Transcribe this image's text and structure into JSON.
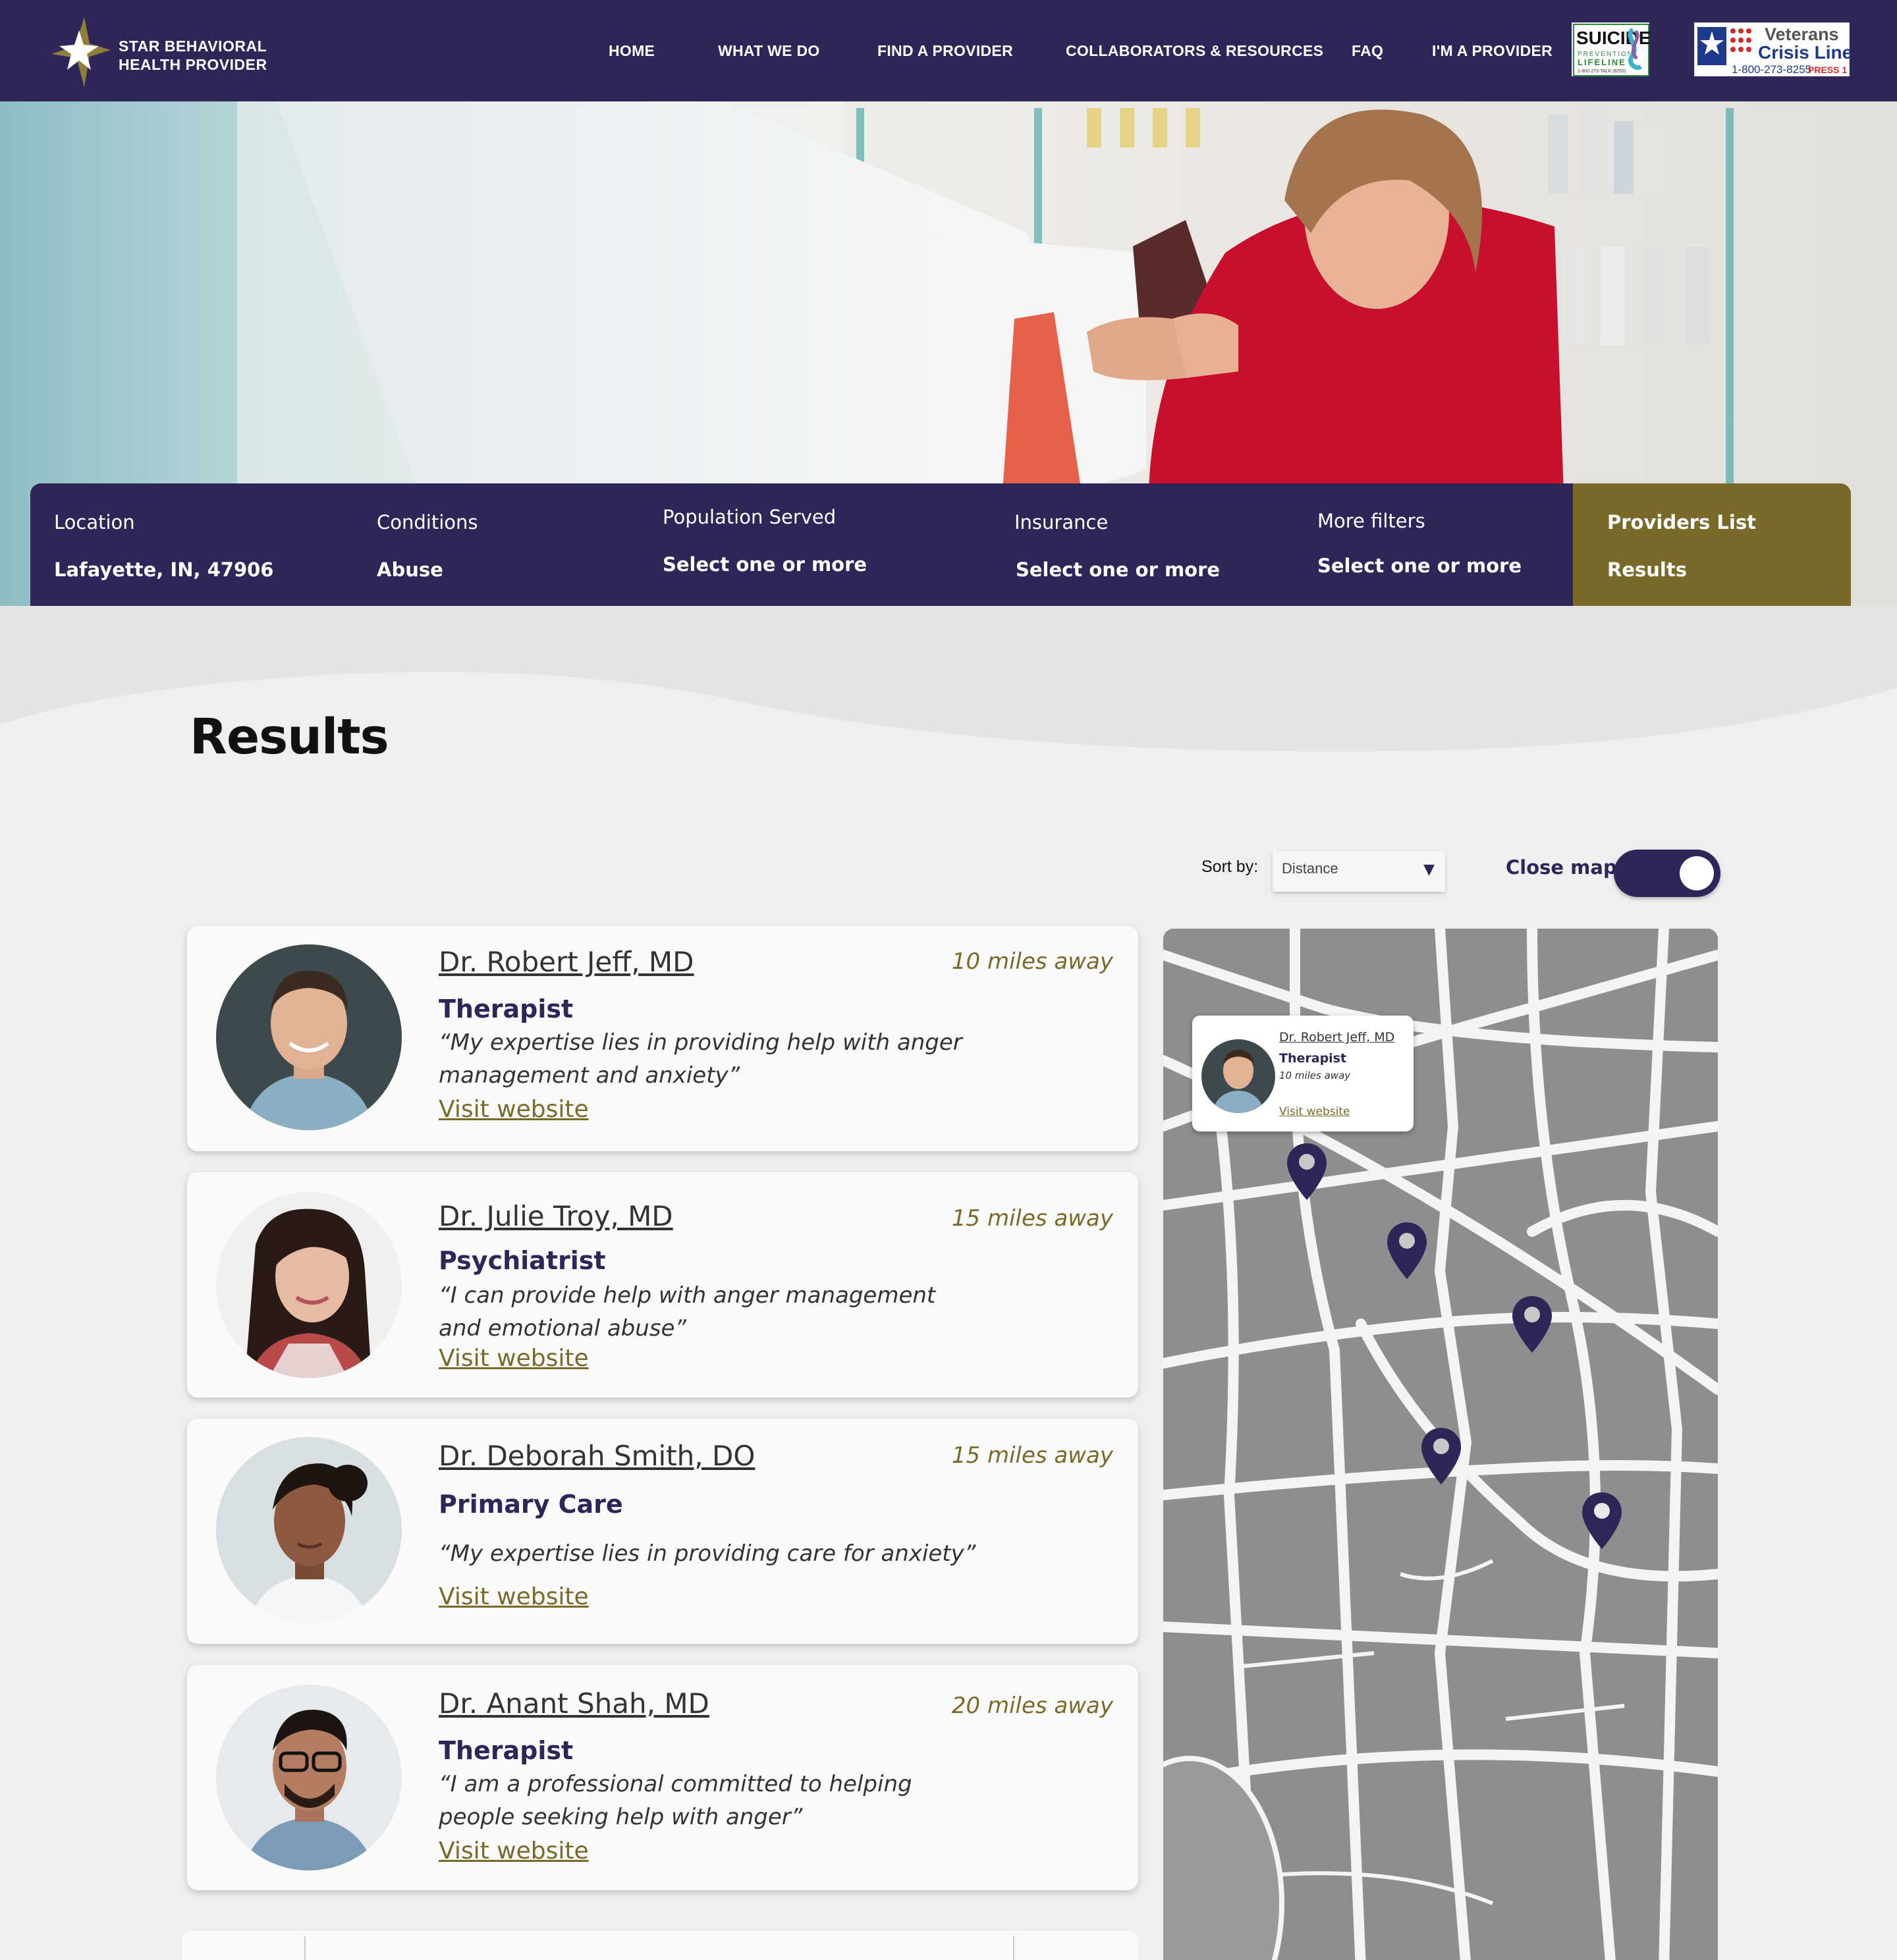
{
  "brand": {
    "line1": "STAR BEHAVIORAL",
    "line2": "HEALTH PROVIDER"
  },
  "nav": [
    {
      "label": "HOME"
    },
    {
      "label": "WHAT WE DO"
    },
    {
      "label": "FIND A PROVIDER"
    },
    {
      "label": "COLLABORATORS & RESOURCES"
    },
    {
      "label": "FAQ"
    },
    {
      "label": "I'M A PROVIDER"
    }
  ],
  "badges": {
    "suicide": {
      "title": "SUICIDE",
      "sub": "PREVENTION",
      "sub2": "LIFELINE",
      "phone": "1-800-273-TALK (8255)"
    },
    "veterans": {
      "line1": "Veterans",
      "line2": "Crisis Line",
      "phone": "1-800-273-8255",
      "press": "PRESS 1"
    }
  },
  "filters": [
    {
      "label": "Location",
      "value": "Lafayette, IN, 47906"
    },
    {
      "label": "Conditions",
      "value": "Abuse"
    },
    {
      "label": "Population Served",
      "value": "Select one or more"
    },
    {
      "label": "Insurance",
      "value": "Select one or more"
    },
    {
      "label": "More filters",
      "value": "Select one or more"
    }
  ],
  "providers_panel": {
    "label": "Providers List",
    "value": "Results"
  },
  "results_title": "Results",
  "sort": {
    "label": "Sort by:",
    "value": "Distance"
  },
  "map_toggle": {
    "label": "Close map",
    "on": true
  },
  "providers": [
    {
      "name": "Dr. Robert Jeff, MD",
      "type": "Therapist",
      "quote": "“My expertise lies in providing help with anger management and anxiety”",
      "link": "Visit website",
      "distance": "10 miles away"
    },
    {
      "name": "Dr. Julie Troy, MD",
      "type": "Psychiatrist",
      "quote": "“I can provide help with anger management and emotional abuse”",
      "link": "Visit website",
      "distance": "15 miles away"
    },
    {
      "name": "Dr. Deborah Smith, DO",
      "type": "Primary Care",
      "quote": "“My expertise lies in providing care for anxiety”",
      "link": "Visit website",
      "distance": "15 miles away"
    },
    {
      "name": "Dr. Anant Shah, MD",
      "type": "Therapist",
      "quote": "“I am a professional committed to helping people seeking help with anger”",
      "link": "Visit website",
      "distance": "20 miles away"
    }
  ],
  "map_tooltip": {
    "name": "Dr. Robert Jeff, MD",
    "type": "Therapist",
    "distance": "10 miles away",
    "link": "Visit website"
  },
  "colors": {
    "primary": "#2e2658",
    "accent": "#7a6a2a",
    "background": "#efefef"
  },
  "icons": [
    "star-logo-icon",
    "suicide-lifeline-logo",
    "veterans-crisis-line-logo",
    "caret-down-icon",
    "map-pin-icon"
  ]
}
